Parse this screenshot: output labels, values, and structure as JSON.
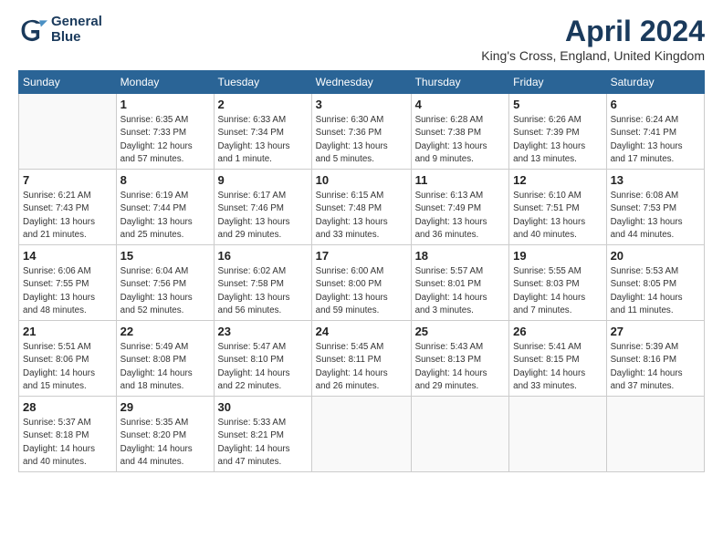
{
  "header": {
    "logo_line1": "General",
    "logo_line2": "Blue",
    "title": "April 2024",
    "subtitle": "King's Cross, England, United Kingdom"
  },
  "days_of_week": [
    "Sunday",
    "Monday",
    "Tuesday",
    "Wednesday",
    "Thursday",
    "Friday",
    "Saturday"
  ],
  "weeks": [
    [
      {
        "day": "",
        "info": ""
      },
      {
        "day": "1",
        "info": "Sunrise: 6:35 AM\nSunset: 7:33 PM\nDaylight: 12 hours\nand 57 minutes."
      },
      {
        "day": "2",
        "info": "Sunrise: 6:33 AM\nSunset: 7:34 PM\nDaylight: 13 hours\nand 1 minute."
      },
      {
        "day": "3",
        "info": "Sunrise: 6:30 AM\nSunset: 7:36 PM\nDaylight: 13 hours\nand 5 minutes."
      },
      {
        "day": "4",
        "info": "Sunrise: 6:28 AM\nSunset: 7:38 PM\nDaylight: 13 hours\nand 9 minutes."
      },
      {
        "day": "5",
        "info": "Sunrise: 6:26 AM\nSunset: 7:39 PM\nDaylight: 13 hours\nand 13 minutes."
      },
      {
        "day": "6",
        "info": "Sunrise: 6:24 AM\nSunset: 7:41 PM\nDaylight: 13 hours\nand 17 minutes."
      }
    ],
    [
      {
        "day": "7",
        "info": "Sunrise: 6:21 AM\nSunset: 7:43 PM\nDaylight: 13 hours\nand 21 minutes."
      },
      {
        "day": "8",
        "info": "Sunrise: 6:19 AM\nSunset: 7:44 PM\nDaylight: 13 hours\nand 25 minutes."
      },
      {
        "day": "9",
        "info": "Sunrise: 6:17 AM\nSunset: 7:46 PM\nDaylight: 13 hours\nand 29 minutes."
      },
      {
        "day": "10",
        "info": "Sunrise: 6:15 AM\nSunset: 7:48 PM\nDaylight: 13 hours\nand 33 minutes."
      },
      {
        "day": "11",
        "info": "Sunrise: 6:13 AM\nSunset: 7:49 PM\nDaylight: 13 hours\nand 36 minutes."
      },
      {
        "day": "12",
        "info": "Sunrise: 6:10 AM\nSunset: 7:51 PM\nDaylight: 13 hours\nand 40 minutes."
      },
      {
        "day": "13",
        "info": "Sunrise: 6:08 AM\nSunset: 7:53 PM\nDaylight: 13 hours\nand 44 minutes."
      }
    ],
    [
      {
        "day": "14",
        "info": "Sunrise: 6:06 AM\nSunset: 7:55 PM\nDaylight: 13 hours\nand 48 minutes."
      },
      {
        "day": "15",
        "info": "Sunrise: 6:04 AM\nSunset: 7:56 PM\nDaylight: 13 hours\nand 52 minutes."
      },
      {
        "day": "16",
        "info": "Sunrise: 6:02 AM\nSunset: 7:58 PM\nDaylight: 13 hours\nand 56 minutes."
      },
      {
        "day": "17",
        "info": "Sunrise: 6:00 AM\nSunset: 8:00 PM\nDaylight: 13 hours\nand 59 minutes."
      },
      {
        "day": "18",
        "info": "Sunrise: 5:57 AM\nSunset: 8:01 PM\nDaylight: 14 hours\nand 3 minutes."
      },
      {
        "day": "19",
        "info": "Sunrise: 5:55 AM\nSunset: 8:03 PM\nDaylight: 14 hours\nand 7 minutes."
      },
      {
        "day": "20",
        "info": "Sunrise: 5:53 AM\nSunset: 8:05 PM\nDaylight: 14 hours\nand 11 minutes."
      }
    ],
    [
      {
        "day": "21",
        "info": "Sunrise: 5:51 AM\nSunset: 8:06 PM\nDaylight: 14 hours\nand 15 minutes."
      },
      {
        "day": "22",
        "info": "Sunrise: 5:49 AM\nSunset: 8:08 PM\nDaylight: 14 hours\nand 18 minutes."
      },
      {
        "day": "23",
        "info": "Sunrise: 5:47 AM\nSunset: 8:10 PM\nDaylight: 14 hours\nand 22 minutes."
      },
      {
        "day": "24",
        "info": "Sunrise: 5:45 AM\nSunset: 8:11 PM\nDaylight: 14 hours\nand 26 minutes."
      },
      {
        "day": "25",
        "info": "Sunrise: 5:43 AM\nSunset: 8:13 PM\nDaylight: 14 hours\nand 29 minutes."
      },
      {
        "day": "26",
        "info": "Sunrise: 5:41 AM\nSunset: 8:15 PM\nDaylight: 14 hours\nand 33 minutes."
      },
      {
        "day": "27",
        "info": "Sunrise: 5:39 AM\nSunset: 8:16 PM\nDaylight: 14 hours\nand 37 minutes."
      }
    ],
    [
      {
        "day": "28",
        "info": "Sunrise: 5:37 AM\nSunset: 8:18 PM\nDaylight: 14 hours\nand 40 minutes."
      },
      {
        "day": "29",
        "info": "Sunrise: 5:35 AM\nSunset: 8:20 PM\nDaylight: 14 hours\nand 44 minutes."
      },
      {
        "day": "30",
        "info": "Sunrise: 5:33 AM\nSunset: 8:21 PM\nDaylight: 14 hours\nand 47 minutes."
      },
      {
        "day": "",
        "info": ""
      },
      {
        "day": "",
        "info": ""
      },
      {
        "day": "",
        "info": ""
      },
      {
        "day": "",
        "info": ""
      }
    ]
  ]
}
